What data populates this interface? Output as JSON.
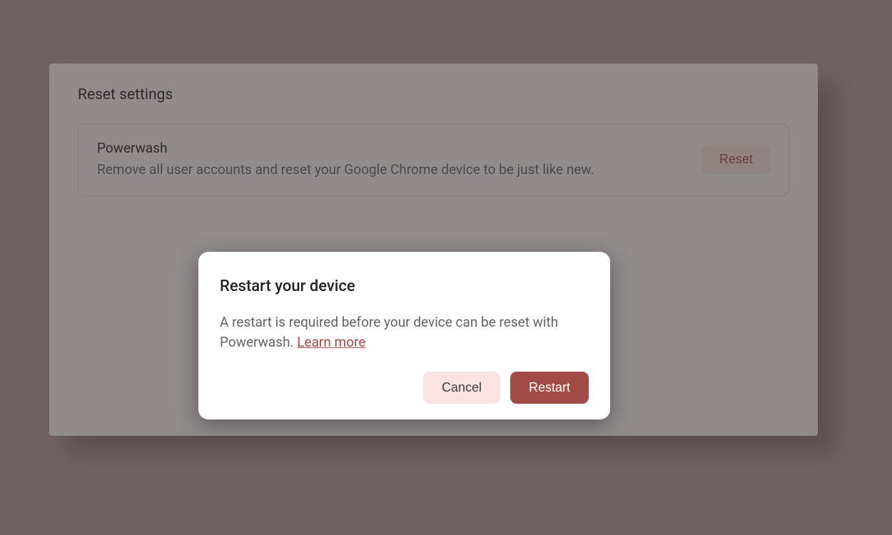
{
  "settings": {
    "section_title": "Reset settings",
    "powerwash": {
      "title": "Powerwash",
      "description": "Remove all user accounts and reset your Google Chrome device to be just like new.",
      "reset_label": "Reset"
    }
  },
  "dialog": {
    "title": "Restart your device",
    "body_prefix": "A restart is required before your device can be reset with Powerwash. ",
    "learn_more_label": "Learn more",
    "cancel_label": "Cancel",
    "restart_label": "Restart"
  }
}
